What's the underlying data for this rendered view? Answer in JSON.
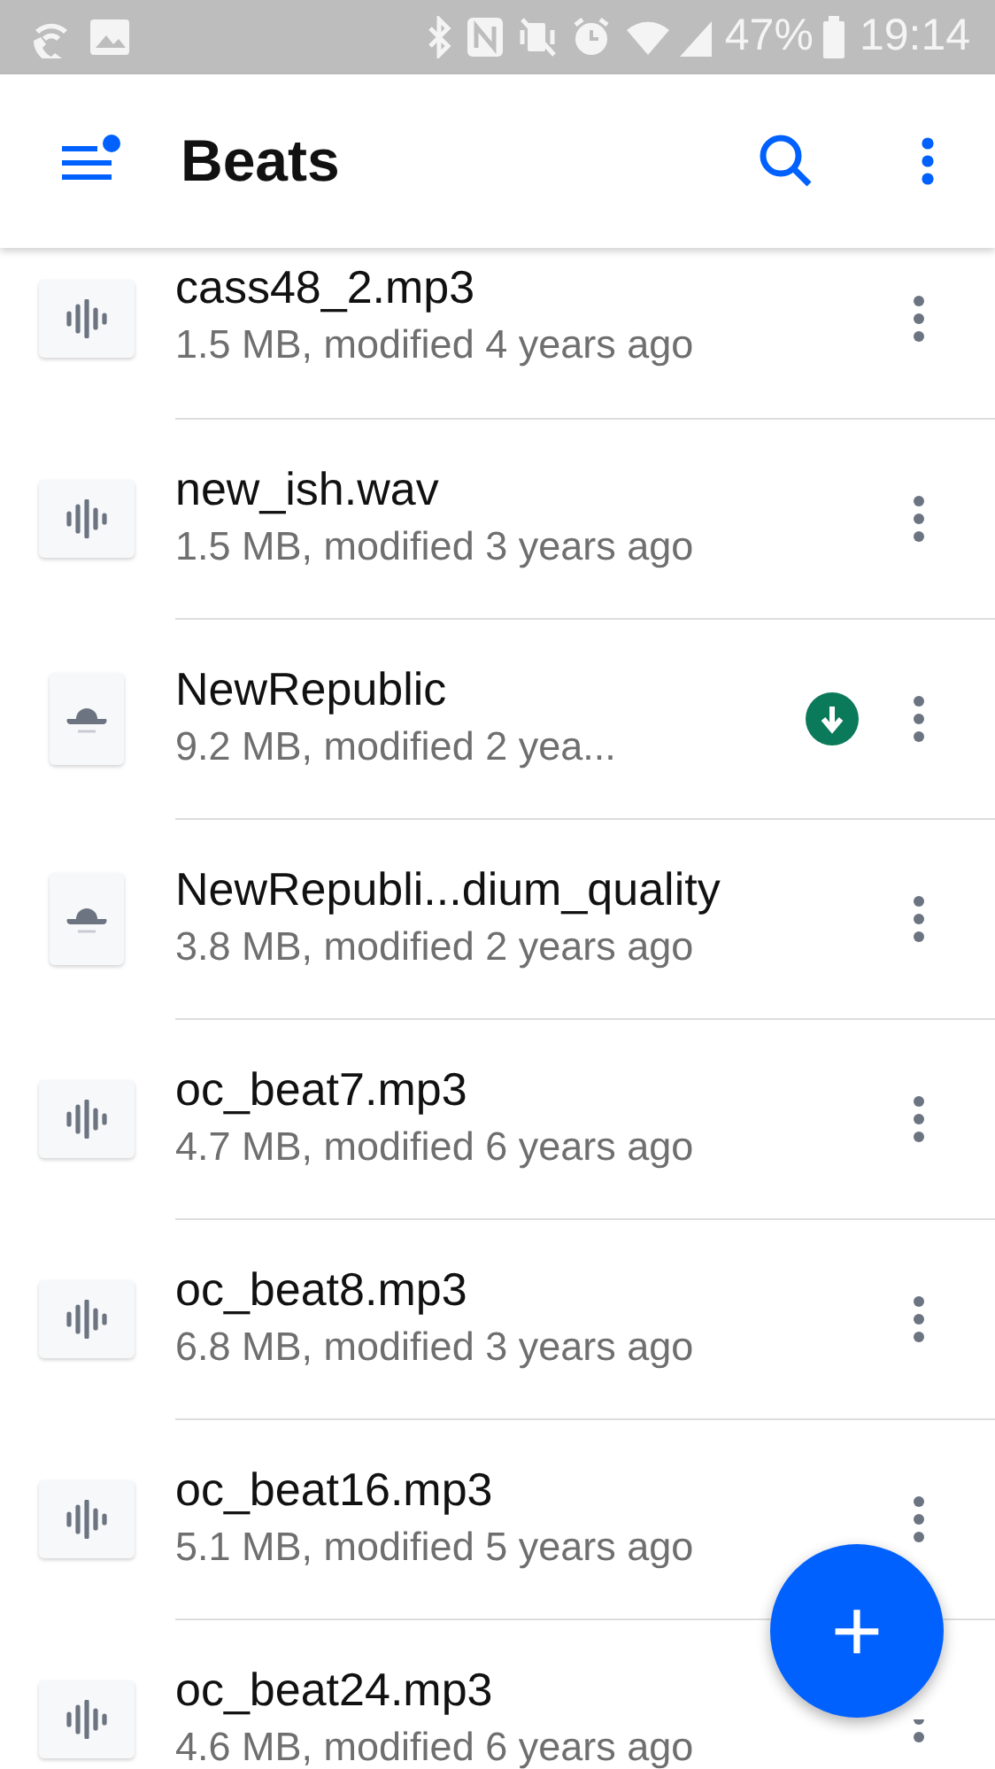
{
  "status_bar": {
    "battery": "47%",
    "time": "19:14"
  },
  "app_bar": {
    "title": "Beats",
    "menu_badge": true
  },
  "files": [
    {
      "name": "cass48_2.mp3",
      "details": "1.5 MB, modified 4 years ago",
      "kind": "audio",
      "downloaded": false
    },
    {
      "name": "new_ish.wav",
      "details": "1.5 MB, modified 3 years ago",
      "kind": "audio",
      "downloaded": false
    },
    {
      "name": "NewRepublic",
      "details": "9.2 MB, modified 2 yea...",
      "kind": "file",
      "downloaded": true
    },
    {
      "name": "NewRepubli...dium_quality",
      "details": "3.8 MB, modified 2 years ago",
      "kind": "file",
      "downloaded": false
    },
    {
      "name": "oc_beat7.mp3",
      "details": "4.7 MB, modified 6 years ago",
      "kind": "audio",
      "downloaded": false
    },
    {
      "name": "oc_beat8.mp3",
      "details": "6.8 MB, modified 3 years ago",
      "kind": "audio",
      "downloaded": false
    },
    {
      "name": "oc_beat16.mp3",
      "details": "5.1 MB, modified 5 years ago",
      "kind": "audio",
      "downloaded": false
    },
    {
      "name": "oc_beat24.mp3",
      "details": "4.6 MB, modified 6 years ago",
      "kind": "audio",
      "downloaded": false
    }
  ],
  "fab": {
    "label": "+"
  }
}
